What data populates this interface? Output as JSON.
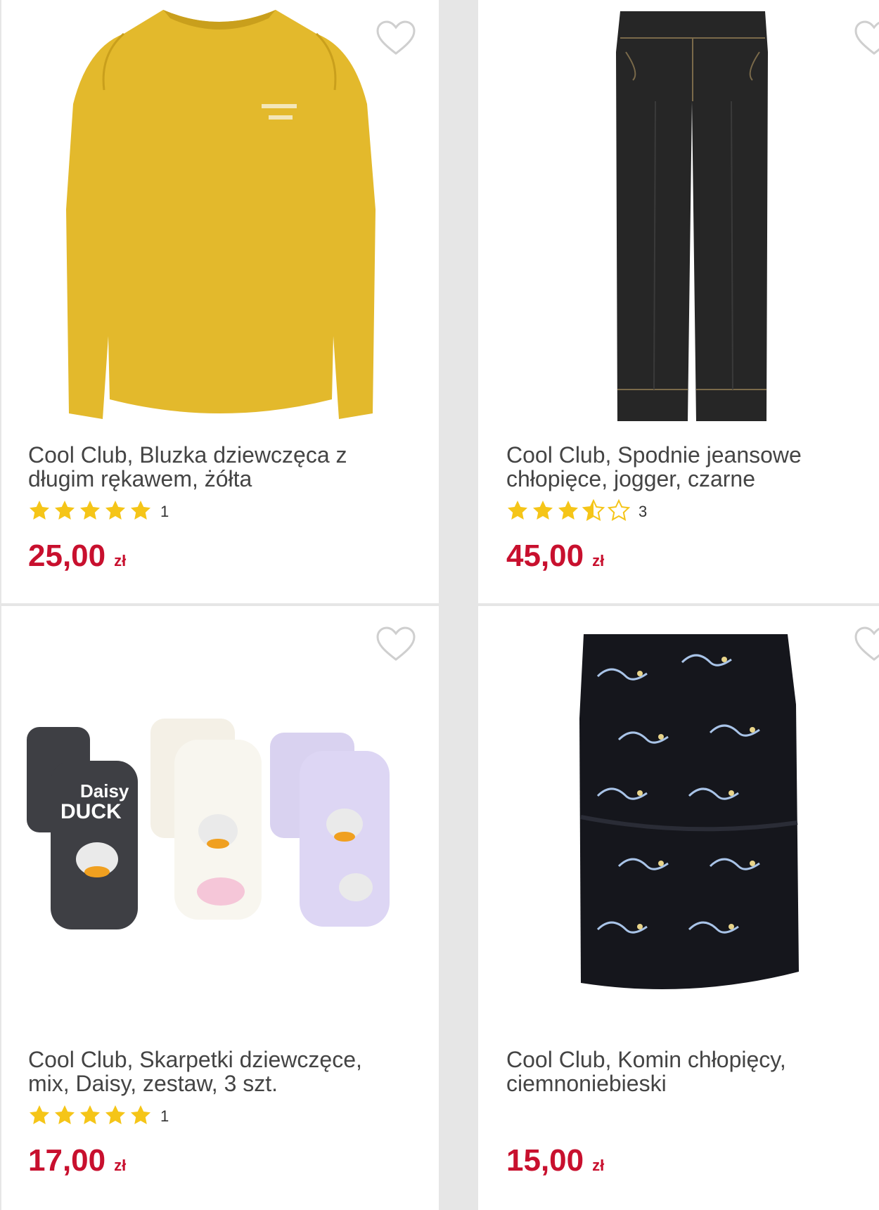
{
  "colors": {
    "price": "#c8102e",
    "star": "#f5c518",
    "title": "#444444"
  },
  "products": [
    {
      "title": "Cool Club, Bluzka dziewczęca z długim rękawem, żółta",
      "rating_stars": 5,
      "rating_count": "1",
      "price": "25,00",
      "currency": "zł",
      "image": "yellow-long-sleeve-blouse"
    },
    {
      "title": "Cool Club, Spodnie jeansowe chłopięce, jogger, czarne",
      "rating_stars": 3.5,
      "rating_count": "3",
      "price": "45,00",
      "currency": "zł",
      "image": "black-denim-jogger-pants"
    },
    {
      "title": "Cool Club, Skarpetki dziewczęce, mix, Daisy, zestaw, 3 szt.",
      "rating_stars": 5,
      "rating_count": "1",
      "price": "17,00",
      "currency": "zł",
      "image": "daisy-duck-socks-set",
      "image_text": [
        "Daisy",
        "DUCK"
      ]
    },
    {
      "title": "Cool Club, Komin chłopięcy, ciemnoniebieski",
      "rating_stars": 0,
      "rating_count": "",
      "price": "15,00",
      "currency": "zł",
      "image": "dinosaur-print-snood"
    }
  ]
}
